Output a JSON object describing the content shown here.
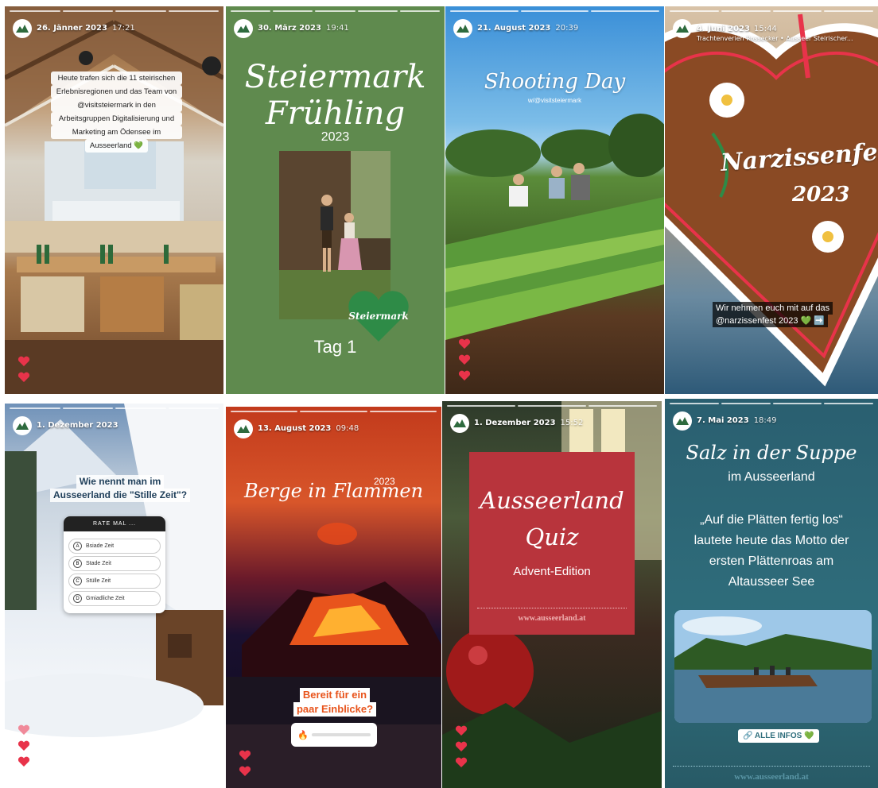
{
  "colors": {
    "green_story": "#5f8a4e",
    "heart_red": "#e8334a",
    "ausseer_red": "#b8343c",
    "teal": "#2f6e7c",
    "brand_green": "#2e8b47"
  },
  "stories": [
    {
      "date": "26. Jänner 2023",
      "time": "17:21",
      "caption_lines": [
        "Heute trafen sich die 11 steirischen",
        "Erlebnisregionen und das Team von",
        "@visitsteiermark in den",
        "Arbeitsgruppen Digitalisierung und",
        "Marketing am Ödensee im",
        "Ausseerland 💚"
      ]
    },
    {
      "date": "30. März 2023",
      "time": "19:41",
      "title_line1": "Steiermark",
      "title_line2": "Frühling",
      "year": "2023",
      "badge": "Steiermark",
      "day": "Tag 1"
    },
    {
      "date": "21. August 2023",
      "time": "20:39",
      "title": "Shooting Day",
      "sub": "w/@visitsteiermark"
    },
    {
      "date": "4. Juni 2023",
      "time": "15:44",
      "music": "Trachtenverien Rossecker • Ausseer Steirischer...",
      "cookie_text": "Narzissenfest",
      "cookie_year": "2023",
      "caption_line1": "Wir nehmen euch mit auf das",
      "caption_line2": "@narzissenfest 2023 💚 ➡️"
    },
    {
      "date": "1. Dezember 2023",
      "time": "",
      "question_line1": "Wie nennt man im",
      "question_line2": "Ausseerland die \"Stille Zeit\"?",
      "quiz_title": "RATE MAL ...",
      "options": [
        {
          "letter": "A",
          "text": "Bsiade Zeit"
        },
        {
          "letter": "B",
          "text": "Stade Zeit"
        },
        {
          "letter": "C",
          "text": "Stülle Zeit"
        },
        {
          "letter": "D",
          "text": "Gmiadliche Zeit"
        }
      ]
    },
    {
      "date": "13. August 2023",
      "time": "09:48",
      "title": "Berge in Flammen",
      "year": "2023",
      "question_line1": "Bereit für ein",
      "question_line2": "paar Einblicke?",
      "slider_emoji": "🔥"
    },
    {
      "date": "1. Dezember 2023",
      "time": "15:52",
      "title_line1": "Ausseerland",
      "title_line2": "Quiz",
      "edition": "Advent-Edition",
      "url": "www.ausseerland.at"
    },
    {
      "date": "7. Mai 2023",
      "time": "18:49",
      "title": "Salz in der Suppe",
      "subtitle": "im Ausseerland",
      "body_lines": [
        "„Auf die Plätten fertig los“",
        "lautete heute das Motto der",
        "ersten Plättenroas am",
        "Altausseer See"
      ],
      "link": "🔗 ALLE INFOS 💚",
      "url": "www.ausseerland.at"
    }
  ]
}
